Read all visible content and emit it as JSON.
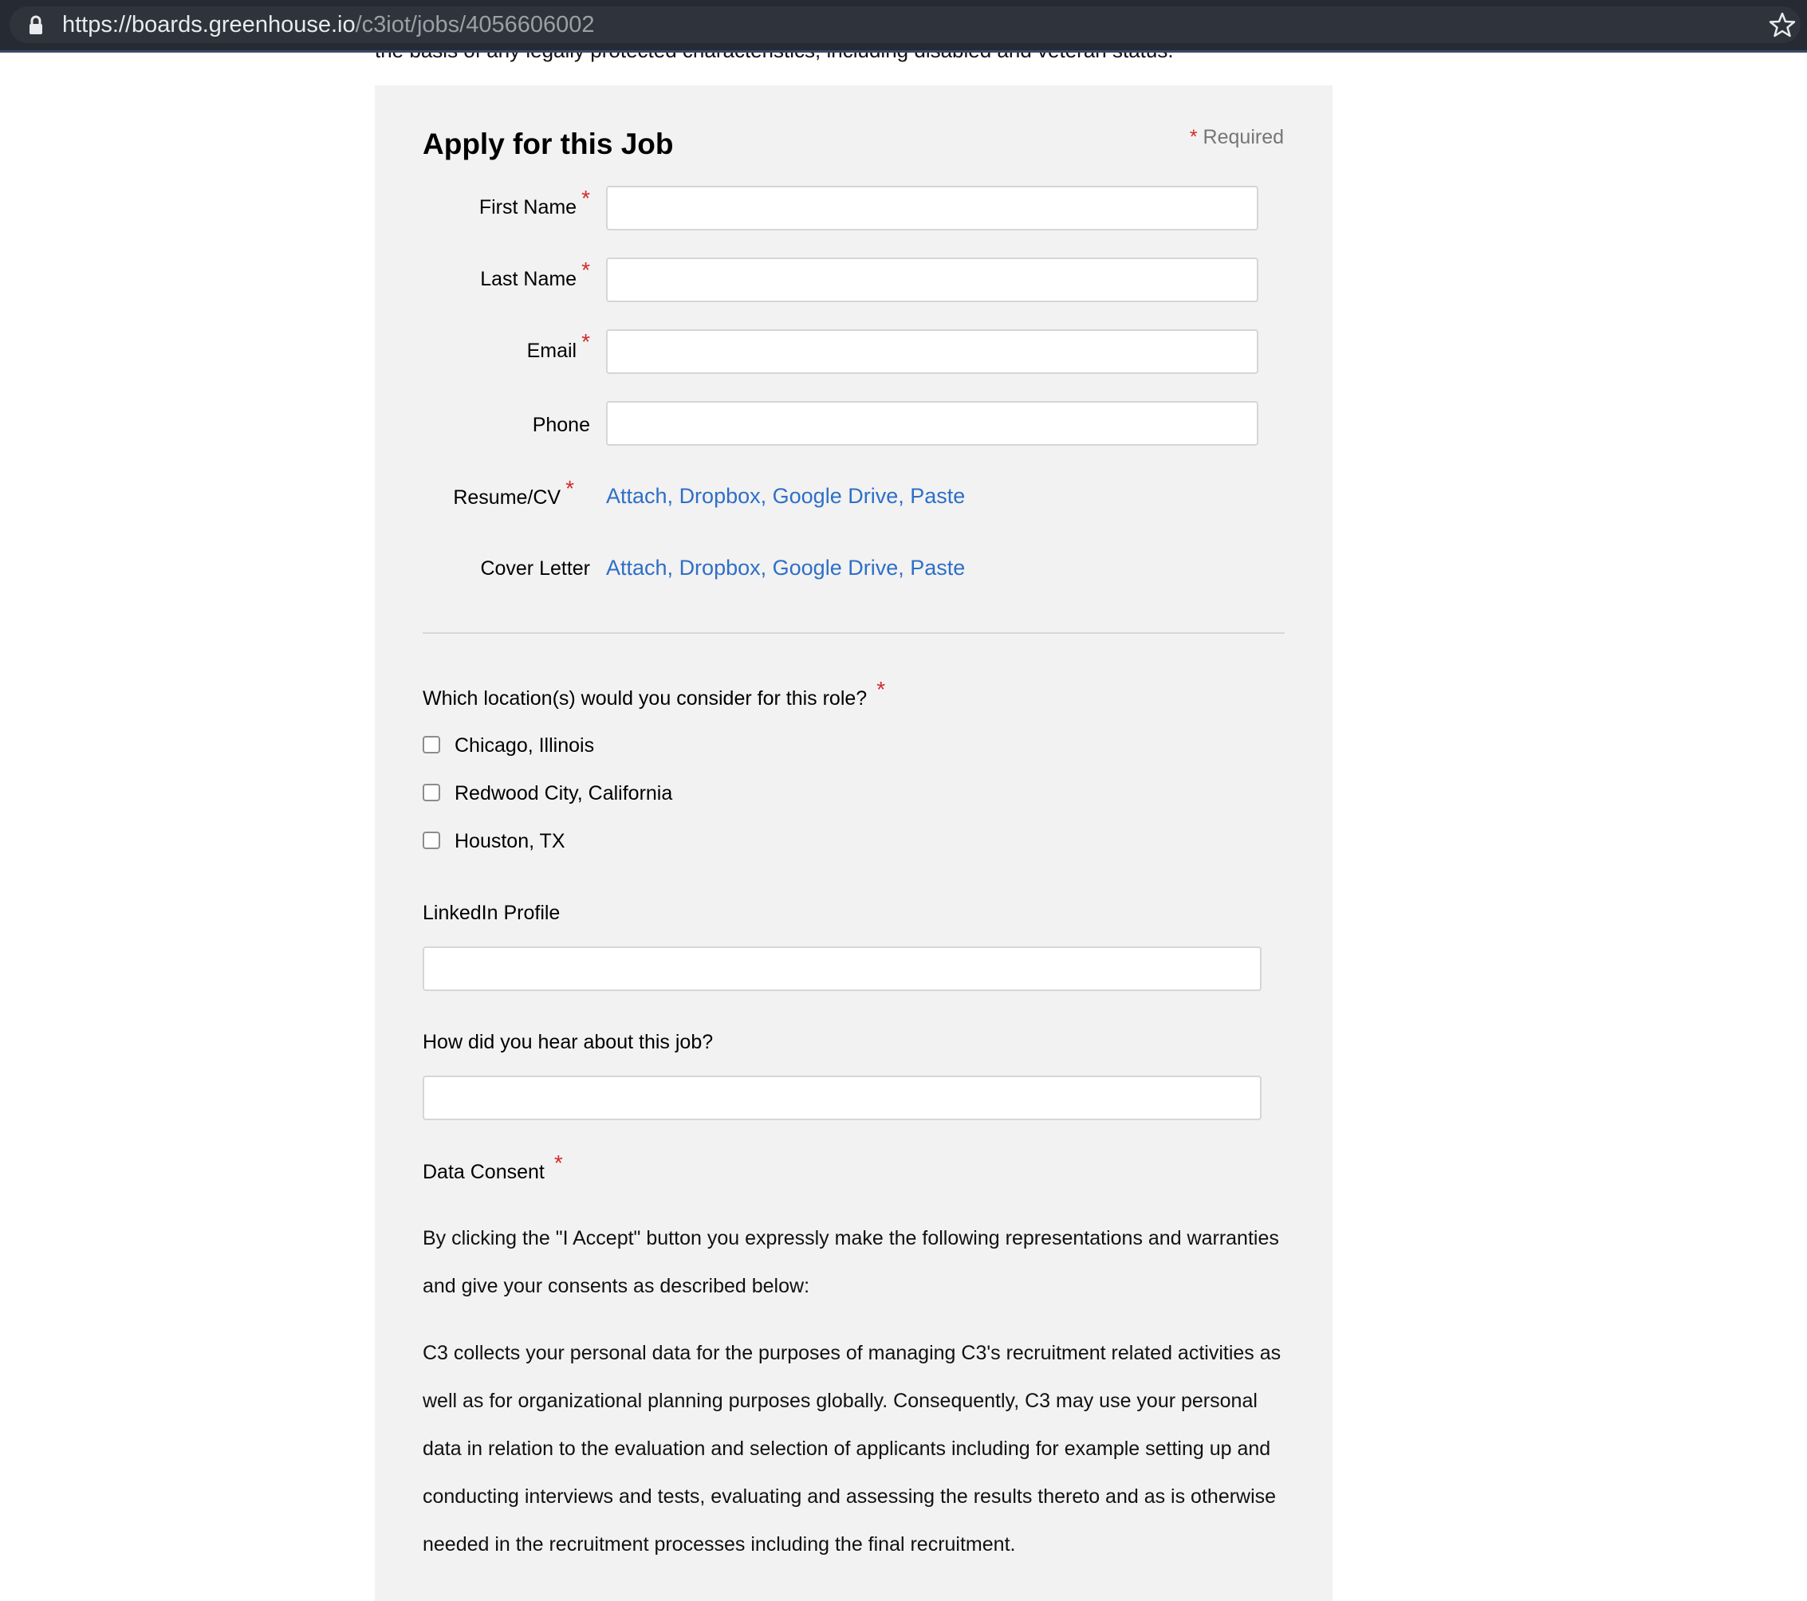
{
  "browser": {
    "url_host": "https://boards.greenhouse.io",
    "url_path": "/c3iot/jobs/4056606002"
  },
  "page": {
    "prior_text": "the basis of any legally protected characteristics, including disabled and veteran status."
  },
  "form": {
    "title": "Apply for this Job",
    "required_note": "Required",
    "asterisk": "*",
    "fields": {
      "first_name": {
        "label": "First Name",
        "value": ""
      },
      "last_name": {
        "label": "Last Name",
        "value": ""
      },
      "email": {
        "label": "Email",
        "value": ""
      },
      "phone": {
        "label": "Phone",
        "value": ""
      }
    },
    "resume": {
      "label": "Resume/CV",
      "links": [
        "Attach",
        "Dropbox",
        "Google Drive",
        "Paste"
      ]
    },
    "cover_letter": {
      "label": "Cover Letter",
      "links": [
        "Attach",
        "Dropbox",
        "Google Drive",
        "Paste"
      ]
    },
    "location_question": {
      "label": "Which location(s) would you consider for this role?",
      "options": [
        {
          "label": "Chicago, Illinois",
          "checked": false
        },
        {
          "label": "Redwood City, California",
          "checked": false
        },
        {
          "label": "Houston, TX",
          "checked": false
        }
      ]
    },
    "linkedin": {
      "label": "LinkedIn Profile",
      "value": ""
    },
    "hear_about": {
      "label": "How did you hear about this job?",
      "value": ""
    },
    "data_consent": {
      "label": "Data Consent",
      "para1": "By clicking the \"I Accept\" button you expressly make the following representations and warranties and give your consents as described below:",
      "para2": "C3 collects your personal data for the purposes of managing C3's recruitment related activities as well as for organizational planning purposes globally. Consequently, C3 may use your personal data in relation to the evaluation and selection of applicants including for example setting up and conducting interviews and tests, evaluating and assessing the results thereto and as is otherwise needed in the recruitment processes including the final recruitment."
    }
  },
  "colors": {
    "link": "#2e6fc7",
    "required": "#d12b2b",
    "panel_bg": "#f2f2f2"
  }
}
